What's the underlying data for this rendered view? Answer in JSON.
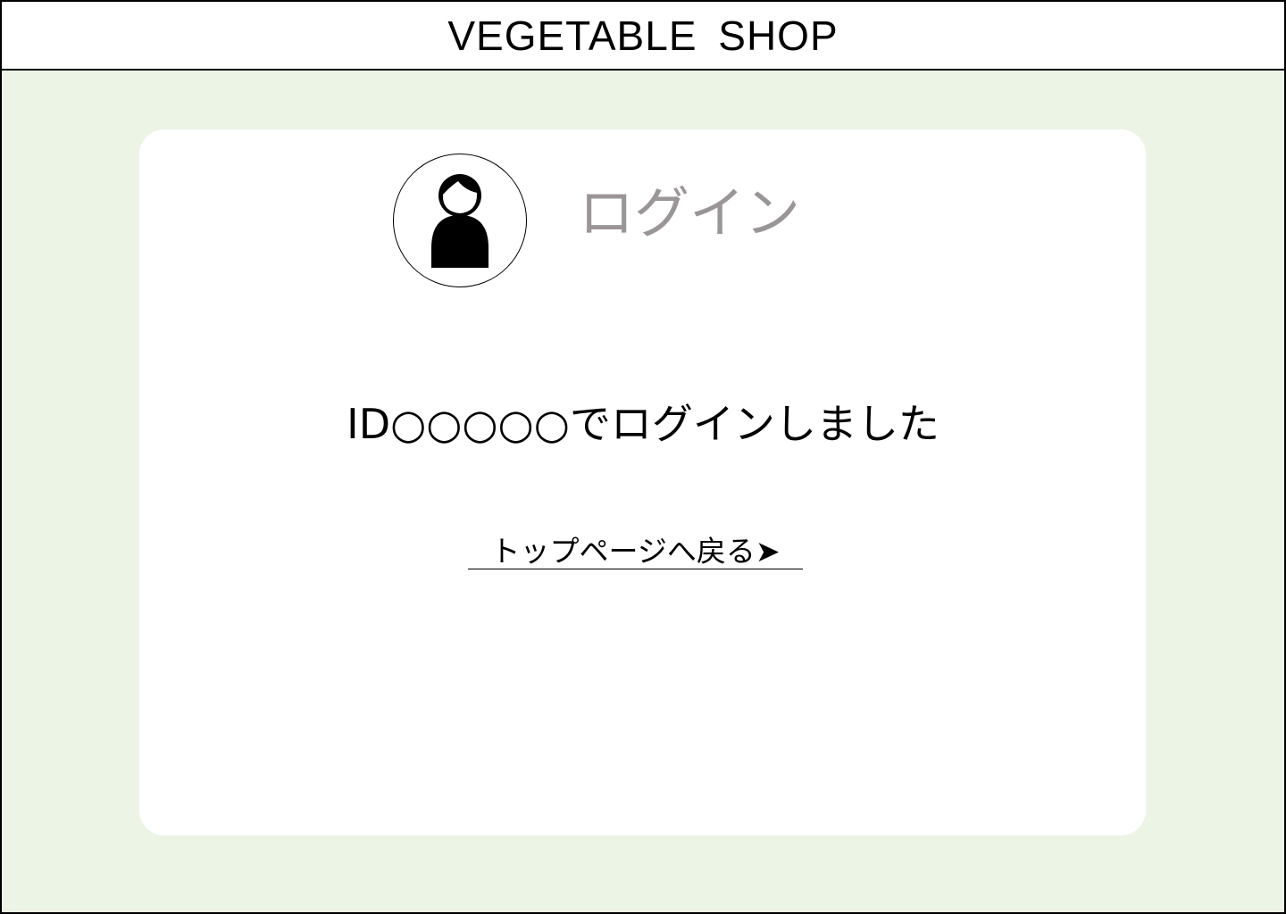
{
  "header": {
    "title": "VEGETABLE SHOP"
  },
  "card": {
    "avatar_icon": "user-icon",
    "title": "ログイン",
    "message": "ID○○○○○でログインしました",
    "back_link": "トップページへ戻る➤"
  },
  "colors": {
    "background": "#ecf4e6",
    "card": "#ffffff",
    "title_gray": "#9a9597"
  }
}
